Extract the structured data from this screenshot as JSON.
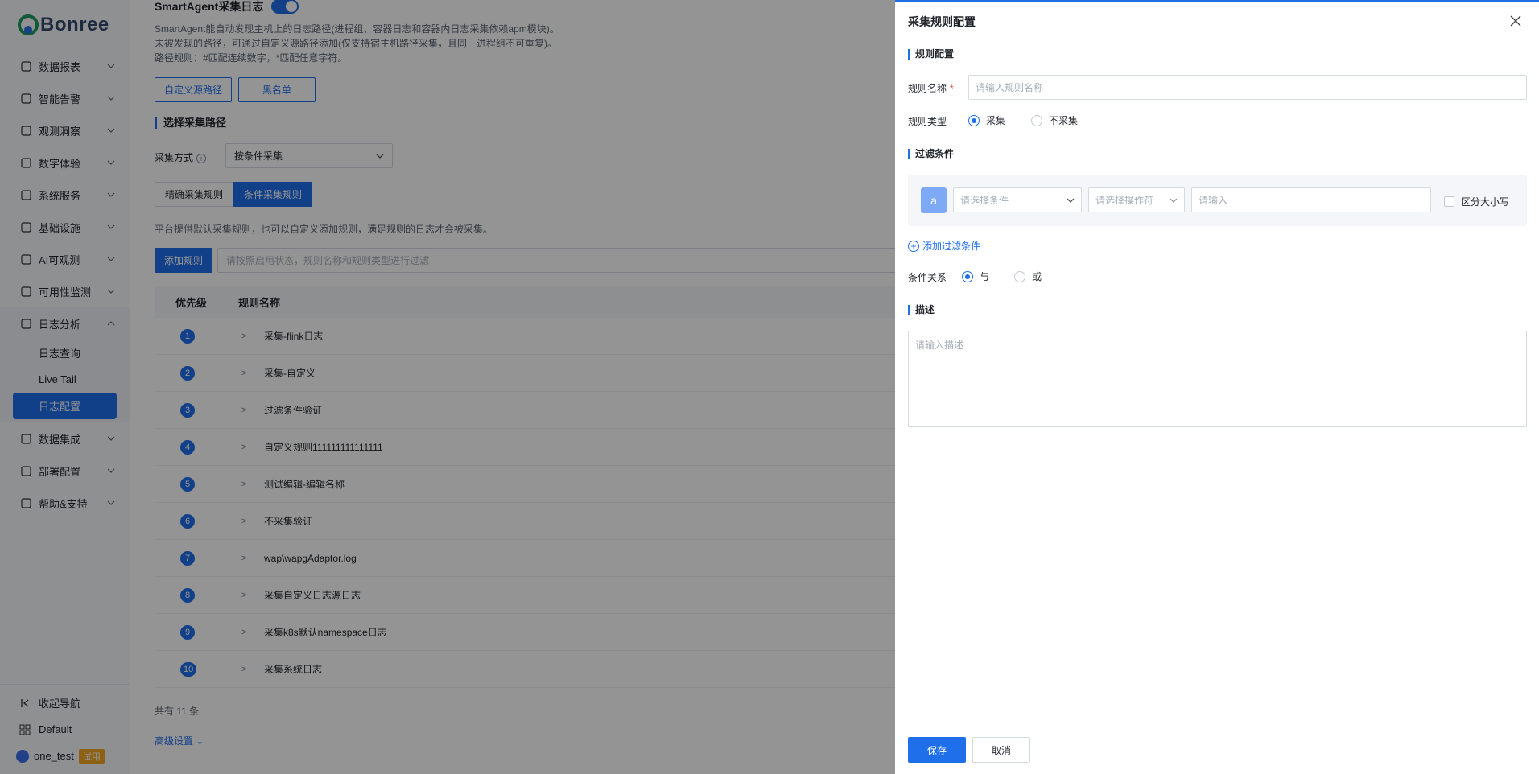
{
  "brand": {
    "name": "Bonree"
  },
  "sidebar": {
    "items": [
      {
        "label": "数据报表",
        "icon": "report-icon"
      },
      {
        "label": "智能告警",
        "icon": "alert-icon"
      },
      {
        "label": "观测洞察",
        "icon": "insight-icon"
      },
      {
        "label": "数字体验",
        "icon": "user-experience-icon"
      },
      {
        "label": "系统服务",
        "icon": "service-icon"
      },
      {
        "label": "基础设施",
        "icon": "infrastructure-icon"
      },
      {
        "label": "AI可观测",
        "icon": "ai-icon"
      },
      {
        "label": "可用性监测",
        "icon": "monitor-icon"
      },
      {
        "label": "日志分析",
        "icon": "log-icon"
      },
      {
        "label": "数据集成",
        "icon": "integration-icon"
      },
      {
        "label": "部署配置",
        "icon": "deploy-icon"
      },
      {
        "label": "帮助&支持",
        "icon": "help-icon"
      }
    ],
    "log_sub": [
      "日志查询",
      "Live Tail",
      "日志配置"
    ],
    "bottom": {
      "collapse": "收起导航",
      "workspace": "Default",
      "user": "one_test",
      "trial": "试用"
    }
  },
  "main": {
    "smartagent_title": "SmartAgent采集日志",
    "desc1": "SmartAgent能自动发现主机上的日志路径(进程组、容器日志和容器内日志采集依赖apm模块)。",
    "desc2": "未被发现的路径，可通过自定义源路径添加(仅支持宿主机路径采集，且同一进程组不可重复)。",
    "desc3": "路径规则：#匹配连续数字，*匹配任意字符。",
    "btn_custom_path": "自定义源路径",
    "btn_blacklist": "黑名单",
    "section_select_path": "选择采集路径",
    "collect_mode_label": "采集方式",
    "collect_mode_value": "按条件采集",
    "seg_exact": "精确采集规则",
    "seg_condition": "条件采集规则",
    "rules_desc": "平台提供默认采集规则，也可以自定义添加规则，满足规则的日志才会被采集。",
    "btn_add_rule": "添加规则",
    "search_placeholder": "请按照启用状态，规则名称和规则类型进行过滤",
    "table_headers": [
      "优先级",
      "规则名称"
    ],
    "rows": [
      {
        "priority": "1",
        "name": "采集-flink日志"
      },
      {
        "priority": "2",
        "name": "采集-自定义"
      },
      {
        "priority": "3",
        "name": "过滤条件验证"
      },
      {
        "priority": "4",
        "name": "自定义规则111111111111111"
      },
      {
        "priority": "5",
        "name": "测试编辑-编辑名称"
      },
      {
        "priority": "6",
        "name": "不采集验证"
      },
      {
        "priority": "7",
        "name": "wap\\wapgAdaptor.log"
      },
      {
        "priority": "8",
        "name": "采集自定义日志源日志"
      },
      {
        "priority": "9",
        "name": "采集k8s默认namespace日志"
      },
      {
        "priority": "10",
        "name": "采集系统日志"
      }
    ],
    "total": "共有 11 条",
    "advanced": "高级设置"
  },
  "drawer": {
    "title": "采集规则配置",
    "section_rule": "规则配置",
    "rule_name_label": "规则名称",
    "rule_name_placeholder": "请输入规则名称",
    "rule_type_label": "规则类型",
    "rule_type_options": [
      "采集",
      "不采集"
    ],
    "section_filter": "过滤条件",
    "filter_tag": "a",
    "condition_placeholder": "请选择条件",
    "operator_placeholder": "请选择操作符",
    "value_placeholder": "请输入",
    "case_sensitive": "区分大小写",
    "add_filter": "添加过滤条件",
    "relation_label": "条件关系",
    "relation_options": [
      "与",
      "或"
    ],
    "section_desc": "描述",
    "desc_placeholder": "请输入描述",
    "save": "保存",
    "cancel": "取消"
  },
  "colors": {
    "primary": "#1f6feb",
    "overlay": "rgba(0,0,0,0.42)"
  }
}
